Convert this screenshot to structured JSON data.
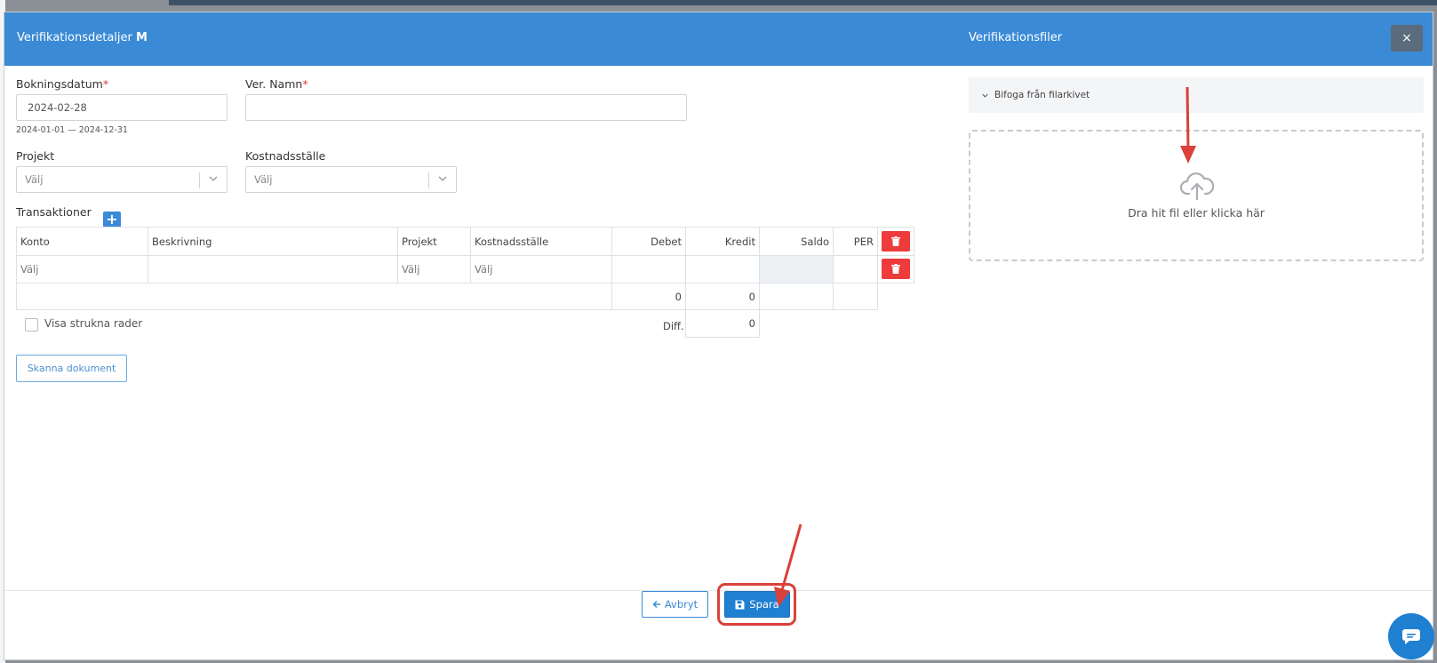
{
  "header": {
    "title": "Verifikationsdetaljer",
    "title_bold": "M",
    "files_title": "Verifikationsfiler",
    "close_label": "×"
  },
  "form": {
    "booking_date_label": "Bokningsdatum",
    "booking_date_value": "2024-02-28",
    "booking_date_range": "2024-01-01 — 2024-12-31",
    "ver_name_label": "Ver. Namn",
    "ver_name_value": "",
    "required_mark": "*",
    "project_label": "Projekt",
    "project_value": "Välj",
    "cost_center_label": "Kostnadsställe",
    "cost_center_value": "Välj"
  },
  "transactions": {
    "title": "Transaktioner",
    "add_label": "+",
    "columns": {
      "konto": "Konto",
      "beskrivning": "Beskrivning",
      "projekt": "Projekt",
      "kostnadsstalle": "Kostnadsställe",
      "debet": "Debet",
      "kredit": "Kredit",
      "saldo": "Saldo",
      "per": "PER"
    },
    "row": {
      "konto": "Välj",
      "beskrivning": "",
      "projekt": "Välj",
      "kostnadsstalle": "Välj",
      "debet": "",
      "kredit": ""
    },
    "totals": {
      "debet": "0",
      "kredit": "0"
    },
    "diff_label": "Diff.",
    "diff_value": "0",
    "show_struck_label": "Visa strukna rader"
  },
  "scan_button_label": "Skanna dokument",
  "files": {
    "attach_label": "Bifoga från filarkivet",
    "drop_text": "Dra hit fil eller klicka här"
  },
  "footer": {
    "cancel_label": "Avbryt",
    "save_label": "Spara"
  },
  "colors": {
    "header_bg": "#3a8ad6",
    "primary": "#1f7fd1",
    "danger": "#ee3b3b",
    "annotation": "#d9413a"
  }
}
